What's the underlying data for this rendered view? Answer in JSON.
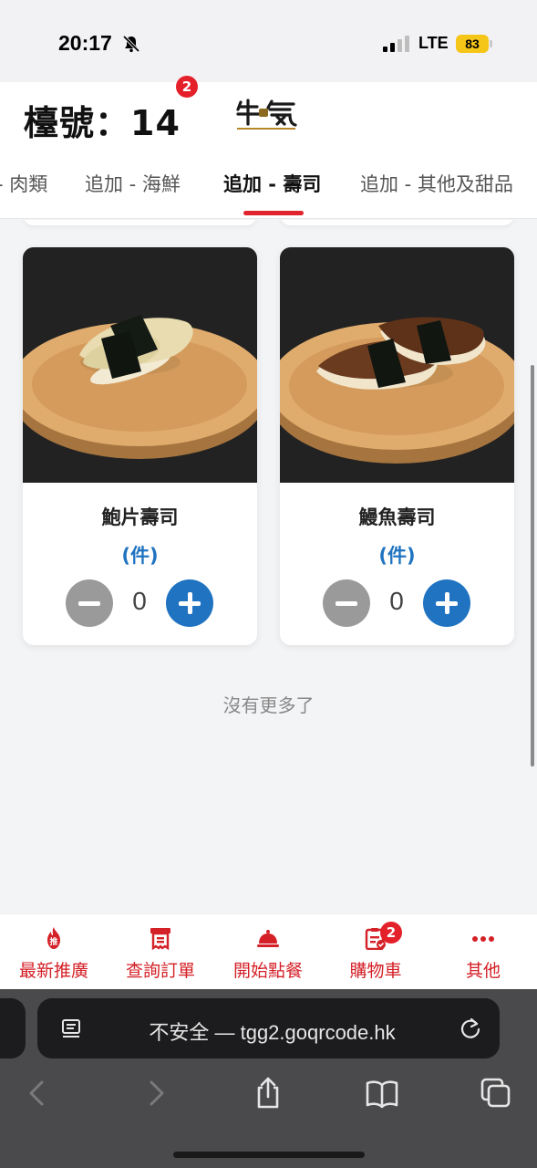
{
  "status_bar": {
    "time": "20:17",
    "network": "LTE",
    "battery": "83"
  },
  "header": {
    "table_label": "檯號：14",
    "brand_logo": "gyu-ki-logo"
  },
  "tabs": [
    {
      "label": "- 肉類",
      "active": false
    },
    {
      "label": "追加 - 海鮮",
      "active": false,
      "badge": "2"
    },
    {
      "label": "追加 - 壽司",
      "active": true
    },
    {
      "label": "追加 - 其他及甜品",
      "active": false
    }
  ],
  "products": [
    {
      "name": "鮑片壽司",
      "unit": "(件)",
      "quantity": "0",
      "image": "abalone-sushi-photo"
    },
    {
      "name": "鰻魚壽司",
      "unit": "(件)",
      "quantity": "0",
      "image": "eel-sushi-photo"
    }
  ],
  "list_end_text": "沒有更多了",
  "bottom_nav": [
    {
      "label": "最新推廣",
      "icon": "fire-recommend-icon"
    },
    {
      "label": "查詢訂單",
      "icon": "receipt-icon"
    },
    {
      "label": "開始點餐",
      "icon": "cloche-icon"
    },
    {
      "label": "購物車",
      "icon": "cart-clipboard-icon",
      "badge": "2"
    },
    {
      "label": "其他",
      "icon": "more-dots-icon"
    }
  ],
  "browser": {
    "url_text": "不安全 — tgg2.goqrcode.hk"
  },
  "colors": {
    "accent_red": "#d42027",
    "primary_blue": "#1f73c1",
    "badge_red": "#e4202a"
  }
}
